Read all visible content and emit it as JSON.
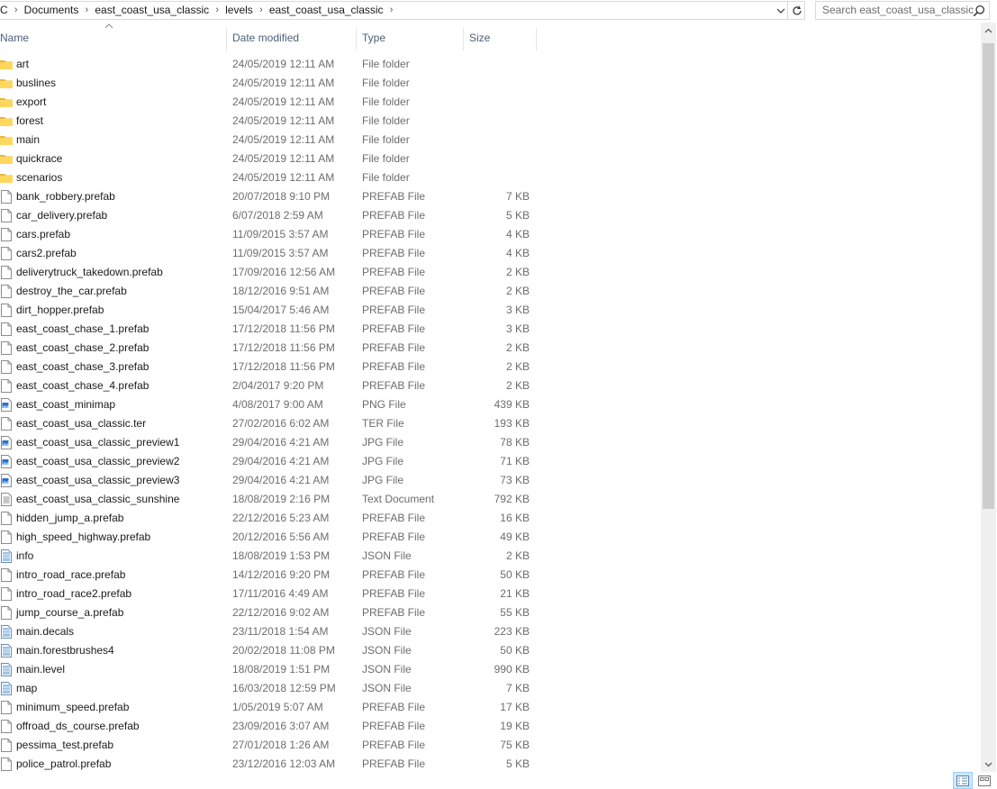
{
  "address": {
    "crumbs": [
      "C",
      "Documents",
      "east_coast_usa_classic",
      "levels",
      "east_coast_usa_classic"
    ],
    "separator": "›"
  },
  "search": {
    "placeholder": "Search east_coast_usa_classic"
  },
  "columns": {
    "name": "Name",
    "date": "Date modified",
    "type": "Type",
    "size": "Size"
  },
  "colors": {
    "folder": "#ffd75e",
    "header_text": "#4c607a",
    "meta_text": "#6d6d6d",
    "selected_view": "#cce8ff"
  },
  "files": [
    {
      "name": "art",
      "date": "24/05/2019 12:11 AM",
      "type": "File folder",
      "size": "",
      "icon": "folder-icon"
    },
    {
      "name": "buslines",
      "date": "24/05/2019 12:11 AM",
      "type": "File folder",
      "size": "",
      "icon": "folder-icon"
    },
    {
      "name": "export",
      "date": "24/05/2019 12:11 AM",
      "type": "File folder",
      "size": "",
      "icon": "folder-icon"
    },
    {
      "name": "forest",
      "date": "24/05/2019 12:11 AM",
      "type": "File folder",
      "size": "",
      "icon": "folder-icon"
    },
    {
      "name": "main",
      "date": "24/05/2019 12:11 AM",
      "type": "File folder",
      "size": "",
      "icon": "folder-icon"
    },
    {
      "name": "quickrace",
      "date": "24/05/2019 12:11 AM",
      "type": "File folder",
      "size": "",
      "icon": "folder-icon"
    },
    {
      "name": "scenarios",
      "date": "24/05/2019 12:11 AM",
      "type": "File folder",
      "size": "",
      "icon": "folder-icon"
    },
    {
      "name": "bank_robbery.prefab",
      "date": "20/07/2018 9:10 PM",
      "type": "PREFAB File",
      "size": "7 KB",
      "icon": "file-icon"
    },
    {
      "name": "car_delivery.prefab",
      "date": "6/07/2018 2:59 AM",
      "type": "PREFAB File",
      "size": "5 KB",
      "icon": "file-icon"
    },
    {
      "name": "cars.prefab",
      "date": "11/09/2015 3:57 AM",
      "type": "PREFAB File",
      "size": "4 KB",
      "icon": "file-icon"
    },
    {
      "name": "cars2.prefab",
      "date": "11/09/2015 3:57 AM",
      "type": "PREFAB File",
      "size": "4 KB",
      "icon": "file-icon"
    },
    {
      "name": "deliverytruck_takedown.prefab",
      "date": "17/09/2016 12:56 AM",
      "type": "PREFAB File",
      "size": "2 KB",
      "icon": "file-icon"
    },
    {
      "name": "destroy_the_car.prefab",
      "date": "18/12/2016 9:51 AM",
      "type": "PREFAB File",
      "size": "2 KB",
      "icon": "file-icon"
    },
    {
      "name": "dirt_hopper.prefab",
      "date": "15/04/2017 5:46 AM",
      "type": "PREFAB File",
      "size": "3 KB",
      "icon": "file-icon"
    },
    {
      "name": "east_coast_chase_1.prefab",
      "date": "17/12/2018 11:56 PM",
      "type": "PREFAB File",
      "size": "3 KB",
      "icon": "file-icon"
    },
    {
      "name": "east_coast_chase_2.prefab",
      "date": "17/12/2018 11:56 PM",
      "type": "PREFAB File",
      "size": "2 KB",
      "icon": "file-icon"
    },
    {
      "name": "east_coast_chase_3.prefab",
      "date": "17/12/2018 11:56 PM",
      "type": "PREFAB File",
      "size": "2 KB",
      "icon": "file-icon"
    },
    {
      "name": "east_coast_chase_4.prefab",
      "date": "2/04/2017 9:20 PM",
      "type": "PREFAB File",
      "size": "2 KB",
      "icon": "file-icon"
    },
    {
      "name": "east_coast_minimap",
      "date": "4/08/2017 9:00 AM",
      "type": "PNG File",
      "size": "439 KB",
      "icon": "image-icon"
    },
    {
      "name": "east_coast_usa_classic.ter",
      "date": "27/02/2016 6:02 AM",
      "type": "TER File",
      "size": "193 KB",
      "icon": "file-icon"
    },
    {
      "name": "east_coast_usa_classic_preview1",
      "date": "29/04/2016 4:21 AM",
      "type": "JPG File",
      "size": "78 KB",
      "icon": "image-icon"
    },
    {
      "name": "east_coast_usa_classic_preview2",
      "date": "29/04/2016 4:21 AM",
      "type": "JPG File",
      "size": "71 KB",
      "icon": "image-icon"
    },
    {
      "name": "east_coast_usa_classic_preview3",
      "date": "29/04/2016 4:21 AM",
      "type": "JPG File",
      "size": "73 KB",
      "icon": "image-icon"
    },
    {
      "name": "east_coast_usa_classic_sunshine",
      "date": "18/08/2019 2:16 PM",
      "type": "Text Document",
      "size": "792 KB",
      "icon": "text-file-icon"
    },
    {
      "name": "hidden_jump_a.prefab",
      "date": "22/12/2016 5:23 AM",
      "type": "PREFAB File",
      "size": "16 KB",
      "icon": "file-icon"
    },
    {
      "name": "high_speed_highway.prefab",
      "date": "20/12/2016 5:56 AM",
      "type": "PREFAB File",
      "size": "49 KB",
      "icon": "file-icon"
    },
    {
      "name": "info",
      "date": "18/08/2019 1:53 PM",
      "type": "JSON File",
      "size": "2 KB",
      "icon": "json-file-icon"
    },
    {
      "name": "intro_road_race.prefab",
      "date": "14/12/2016 9:20 PM",
      "type": "PREFAB File",
      "size": "50 KB",
      "icon": "file-icon"
    },
    {
      "name": "intro_road_race2.prefab",
      "date": "17/11/2016 4:49 AM",
      "type": "PREFAB File",
      "size": "21 KB",
      "icon": "file-icon"
    },
    {
      "name": "jump_course_a.prefab",
      "date": "22/12/2016 9:02 AM",
      "type": "PREFAB File",
      "size": "55 KB",
      "icon": "file-icon"
    },
    {
      "name": "main.decals",
      "date": "23/11/2018 1:54 AM",
      "type": "JSON File",
      "size": "223 KB",
      "icon": "json-file-icon"
    },
    {
      "name": "main.forestbrushes4",
      "date": "20/02/2018 11:08 PM",
      "type": "JSON File",
      "size": "50 KB",
      "icon": "json-file-icon"
    },
    {
      "name": "main.level",
      "date": "18/08/2019 1:51 PM",
      "type": "JSON File",
      "size": "990 KB",
      "icon": "json-file-icon"
    },
    {
      "name": "map",
      "date": "16/03/2018 12:59 PM",
      "type": "JSON File",
      "size": "7 KB",
      "icon": "json-file-icon"
    },
    {
      "name": "minimum_speed.prefab",
      "date": "1/05/2019 5:07 AM",
      "type": "PREFAB File",
      "size": "17 KB",
      "icon": "file-icon"
    },
    {
      "name": "offroad_ds_course.prefab",
      "date": "23/09/2016 3:07 AM",
      "type": "PREFAB File",
      "size": "19 KB",
      "icon": "file-icon"
    },
    {
      "name": "pessima_test.prefab",
      "date": "27/01/2018 1:26 AM",
      "type": "PREFAB File",
      "size": "75 KB",
      "icon": "file-icon"
    },
    {
      "name": "police_patrol.prefab",
      "date": "23/12/2016 12:03 AM",
      "type": "PREFAB File",
      "size": "5 KB",
      "icon": "file-icon"
    }
  ]
}
